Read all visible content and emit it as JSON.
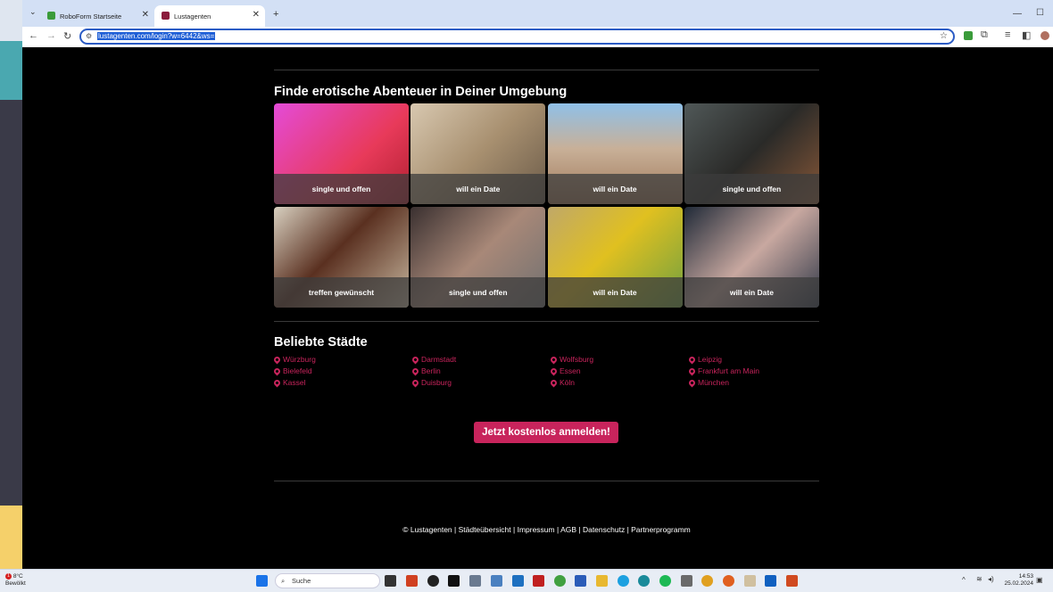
{
  "browser": {
    "tabs": [
      {
        "title": "RoboForm Startseite",
        "fav_color": "#3a9b3a"
      },
      {
        "title": "Lustagenten",
        "fav_color": "#8b1c3c"
      }
    ],
    "url": "lustagenten.com/login?w=6442&ws="
  },
  "page": {
    "section1_title": "Finde erotische Abenteuer in Deiner Umgebung",
    "profiles": [
      {
        "caption": "single und offen",
        "bg": "linear-gradient(135deg,#e44bd8,#e83a5a 60%,#b02030)"
      },
      {
        "caption": "will ein Date",
        "bg": "linear-gradient(135deg,#d8c8b0,#a89070 50%,#6a5a48)"
      },
      {
        "caption": "will ein Date",
        "bg": "linear-gradient(180deg,#8fc0e8,#c8b098 45%,#a07858)"
      },
      {
        "caption": "single und offen",
        "bg": "linear-gradient(135deg,#505858,#2a2a28 50%,#885838)"
      },
      {
        "caption": "treffen gewünscht",
        "bg": "linear-gradient(135deg,#d8d0c0,#5a3020 45%,#c8b8a0)"
      },
      {
        "caption": "single und offen",
        "bg": "linear-gradient(135deg,#3a3030,#a88878 50%,#707070)"
      },
      {
        "caption": "will ein Date",
        "bg": "linear-gradient(135deg,#c0a868,#e0c020 45%,#70a040)"
      },
      {
        "caption": "will ein Date",
        "bg": "linear-gradient(135deg,#202a38,#c8a8a0 50%,#303848)"
      }
    ],
    "section2_title": "Beliebte Städte",
    "cities": [
      [
        "Würzburg",
        "Bielefeld",
        "Kassel"
      ],
      [
        "Darmstadt",
        "Berlin",
        "Duisburg"
      ],
      [
        "Wolfsburg",
        "Essen",
        "Köln"
      ],
      [
        "Leipzig",
        "Frankfurt am Main",
        "München"
      ]
    ],
    "cta_label": "Jetzt kostenlos anmelden!",
    "footer": "© Lustagenten | Städteübersicht | Impressum | AGB | Datenschutz | Partnerprogramm",
    "accent_color": "#c8245c"
  },
  "taskbar": {
    "weather_temp": "8°C",
    "weather_desc": "Bewölkt",
    "weather_badge": "1",
    "search_placeholder": "Suche",
    "time": "14:53",
    "date": "25.02.2024"
  }
}
